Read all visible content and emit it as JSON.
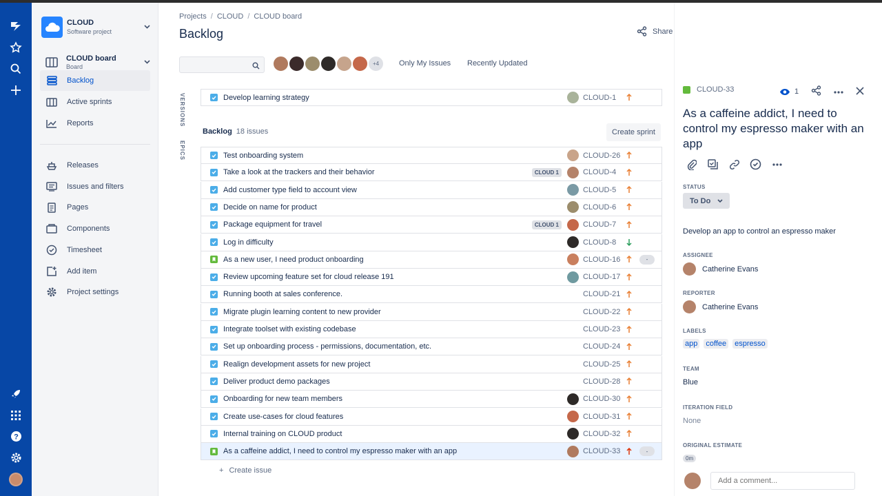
{
  "project": {
    "name": "CLOUD",
    "type": "Software project",
    "board_name": "CLOUD board",
    "board_type": "Board"
  },
  "sidebar": {
    "items": [
      {
        "label": "Backlog",
        "icon": "backlog-icon",
        "active": true
      },
      {
        "label": "Active sprints",
        "icon": "columns-icon"
      },
      {
        "label": "Reports",
        "icon": "chart-icon"
      },
      {
        "label": "Releases",
        "icon": "ship-icon"
      },
      {
        "label": "Issues and filters",
        "icon": "filter-icon"
      },
      {
        "label": "Pages",
        "icon": "page-icon"
      },
      {
        "label": "Components",
        "icon": "component-icon"
      },
      {
        "label": "Timesheet",
        "icon": "check-circle-icon"
      },
      {
        "label": "Add item",
        "icon": "add-item-icon"
      },
      {
        "label": "Project settings",
        "icon": "gear-icon"
      }
    ]
  },
  "breadcrumbs": [
    "Projects",
    "CLOUD",
    "CLOUD board"
  ],
  "page_title": "Backlog",
  "share_label": "Share",
  "toolbar": {
    "search_value": "",
    "avatars_more": "+4",
    "filter_1": "Only My Issues",
    "filter_2": "Recently Updated"
  },
  "side_tabs": {
    "versions": "VERSIONS",
    "epics": "EPICS"
  },
  "sprint_row": {
    "summary": "Develop learning strategy",
    "key": "CLOUD-1",
    "priority": "up"
  },
  "backlog": {
    "title": "Backlog",
    "count": "18 issues",
    "create_sprint": "Create sprint",
    "create_issue": "Create issue"
  },
  "issues": [
    {
      "summary": "Test onboarding system",
      "key": "CLOUD-26",
      "type": "task",
      "epic": "",
      "avatar": true,
      "priority": "up",
      "est": ""
    },
    {
      "summary": "Take a look at the trackers and their behavior",
      "key": "CLOUD-4",
      "type": "task",
      "epic": "CLOUD 1",
      "avatar": true,
      "priority": "up",
      "est": ""
    },
    {
      "summary": "Add customer type field to account view",
      "key": "CLOUD-5",
      "type": "task",
      "epic": "",
      "avatar": true,
      "priority": "up",
      "est": ""
    },
    {
      "summary": "Decide on name for product",
      "key": "CLOUD-6",
      "type": "task",
      "epic": "",
      "avatar": true,
      "priority": "up",
      "est": ""
    },
    {
      "summary": "Package equipment for travel",
      "key": "CLOUD-7",
      "type": "task",
      "epic": "CLOUD 1",
      "avatar": true,
      "priority": "up",
      "est": ""
    },
    {
      "summary": "Log in difficulty",
      "key": "CLOUD-8",
      "type": "task",
      "epic": "",
      "avatar": true,
      "priority": "down",
      "est": ""
    },
    {
      "summary": "As a new user, I need product onboarding",
      "key": "CLOUD-16",
      "type": "story",
      "epic": "",
      "avatar": true,
      "priority": "up",
      "est": "-"
    },
    {
      "summary": "Review upcoming feature set for cloud release 191",
      "key": "CLOUD-17",
      "type": "task",
      "epic": "",
      "avatar": true,
      "priority": "up",
      "est": ""
    },
    {
      "summary": "Running booth at sales conference.",
      "key": "CLOUD-21",
      "type": "task",
      "epic": "",
      "avatar": false,
      "priority": "up",
      "est": ""
    },
    {
      "summary": "Migrate plugin learning content to new provider",
      "key": "CLOUD-22",
      "type": "task",
      "epic": "",
      "avatar": false,
      "priority": "up",
      "est": ""
    },
    {
      "summary": "Integrate toolset with existing codebase",
      "key": "CLOUD-23",
      "type": "task",
      "epic": "",
      "avatar": false,
      "priority": "up",
      "est": ""
    },
    {
      "summary": "Set up onboarding process - permissions, documentation, etc.",
      "key": "CLOUD-24",
      "type": "task",
      "epic": "",
      "avatar": false,
      "priority": "up",
      "est": ""
    },
    {
      "summary": "Realign development assets for new project",
      "key": "CLOUD-25",
      "type": "task",
      "epic": "",
      "avatar": false,
      "priority": "up",
      "est": ""
    },
    {
      "summary": "Deliver product demo packages",
      "key": "CLOUD-28",
      "type": "task",
      "epic": "",
      "avatar": false,
      "priority": "up",
      "est": ""
    },
    {
      "summary": "Onboarding for new team members",
      "key": "CLOUD-30",
      "type": "task",
      "epic": "",
      "avatar": true,
      "priority": "up",
      "est": ""
    },
    {
      "summary": "Create use-cases for cloud features",
      "key": "CLOUD-31",
      "type": "task",
      "epic": "",
      "avatar": true,
      "priority": "up",
      "est": ""
    },
    {
      "summary": "Internal training on CLOUD product",
      "key": "CLOUD-32",
      "type": "task",
      "epic": "",
      "avatar": true,
      "priority": "up",
      "est": ""
    },
    {
      "summary": "As a caffeine addict, I need to control my espresso maker with an app",
      "key": "CLOUD-33",
      "type": "story",
      "epic": "",
      "avatar": true,
      "priority": "high",
      "est": "-",
      "selected": true
    }
  ],
  "detail": {
    "key": "CLOUD-33",
    "watchers": "1",
    "title": "As a caffeine addict, I need to control my espresso maker with an app",
    "status_label": "STATUS",
    "status": "To Do",
    "description": "Develop an app to control an espresso maker",
    "assignee_label": "ASSIGNEE",
    "assignee": "Catherine Evans",
    "reporter_label": "REPORTER",
    "reporter": "Catherine Evans",
    "labels_label": "LABELS",
    "labels": [
      "app",
      "coffee",
      "espresso"
    ],
    "team_label": "TEAM",
    "team": "Blue",
    "iteration_label": "ITERATION FIELD",
    "iteration": "None",
    "estimate_label": "ORIGINAL ESTIMATE",
    "estimate": "0m",
    "comment_placeholder": "Add a comment..."
  },
  "colors": {
    "nav": "#0747a6",
    "task": "#4bade8",
    "story": "#63ba3c",
    "priority_up": "#e97f33",
    "priority_high": "#de350b",
    "priority_down": "#2a9d5b",
    "link": "#0052cc"
  }
}
